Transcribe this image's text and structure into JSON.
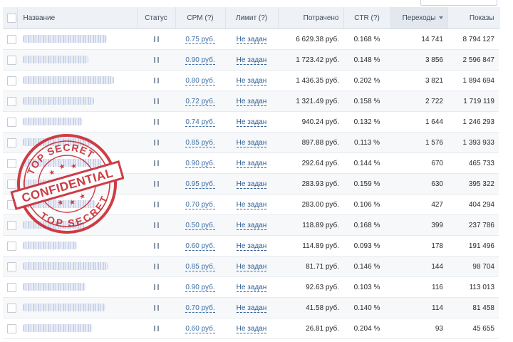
{
  "table": {
    "headers": {
      "name": "Название",
      "status": "Статус",
      "cpm": "CPM (?)",
      "limit": "Лимит (?)",
      "spent": "Потрачено",
      "ctr": "CTR (?)",
      "clicks": "Переходы",
      "shows": "Показы"
    },
    "sort_icon": "sort-desc-icon",
    "rows": [
      {
        "cpm": "0.75 руб.",
        "limit": "Не задан",
        "spent": "6 629.38 руб.",
        "ctr": "0.168 %",
        "clicks": "14 741",
        "shows": "8 794 127"
      },
      {
        "cpm": "0.90 руб.",
        "limit": "Не задан",
        "spent": "1 723.42 руб.",
        "ctr": "0.148 %",
        "clicks": "3 856",
        "shows": "2 596 847"
      },
      {
        "cpm": "0.80 руб.",
        "limit": "Не задан",
        "spent": "1 436.35 руб.",
        "ctr": "0.202 %",
        "clicks": "3 821",
        "shows": "1 894 694"
      },
      {
        "cpm": "0.72 руб.",
        "limit": "Не задан",
        "spent": "1 321.49 руб.",
        "ctr": "0.158 %",
        "clicks": "2 722",
        "shows": "1 719 119"
      },
      {
        "cpm": "0.74 руб.",
        "limit": "Не задан",
        "spent": "940.24 руб.",
        "ctr": "0.132 %",
        "clicks": "1 644",
        "shows": "1 246 293"
      },
      {
        "cpm": "0.85 руб.",
        "limit": "Не задан",
        "spent": "897.88 руб.",
        "ctr": "0.113 %",
        "clicks": "1 576",
        "shows": "1 393 933"
      },
      {
        "cpm": "0.90 руб.",
        "limit": "Не задан",
        "spent": "292.64 руб.",
        "ctr": "0.144 %",
        "clicks": "670",
        "shows": "465 733"
      },
      {
        "cpm": "0.95 руб.",
        "limit": "Не задан",
        "spent": "283.93 руб.",
        "ctr": "0.159 %",
        "clicks": "630",
        "shows": "395 322"
      },
      {
        "cpm": "0.70 руб.",
        "limit": "Не задан",
        "spent": "283.00 руб.",
        "ctr": "0.106 %",
        "clicks": "427",
        "shows": "404 294"
      },
      {
        "cpm": "0.50 руб.",
        "limit": "Не задан",
        "spent": "118.89 руб.",
        "ctr": "0.168 %",
        "clicks": "399",
        "shows": "237 786"
      },
      {
        "cpm": "0.60 руб.",
        "limit": "Не задан",
        "spent": "114.89 руб.",
        "ctr": "0.093 %",
        "clicks": "178",
        "shows": "191 496"
      },
      {
        "cpm": "0.85 руб.",
        "limit": "Не задан",
        "spent": "81.71 руб.",
        "ctr": "0.146 %",
        "clicks": "144",
        "shows": "98 704"
      },
      {
        "cpm": "0.90 руб.",
        "limit": "Не задан",
        "spent": "92.63 руб.",
        "ctr": "0.103 %",
        "clicks": "116",
        "shows": "113 013"
      },
      {
        "cpm": "0.70 руб.",
        "limit": "Не задан",
        "spent": "41.58 руб.",
        "ctr": "0.140 %",
        "clicks": "114",
        "shows": "81 458"
      },
      {
        "cpm": "0.60 руб.",
        "limit": "Не задан",
        "spent": "26.81 руб.",
        "ctr": "0.204 %",
        "clicks": "93",
        "shows": "45 655"
      }
    ]
  },
  "stamp": {
    "top_text": "TOP SECRET",
    "bottom_text": "TOP SECRET",
    "banner": "CONFIDENTIAL",
    "color": "#c8242c"
  },
  "colors": {
    "header_bg": "#eef1f5",
    "link": "#3d6ea8",
    "row_alt": "#f6f8fa"
  }
}
